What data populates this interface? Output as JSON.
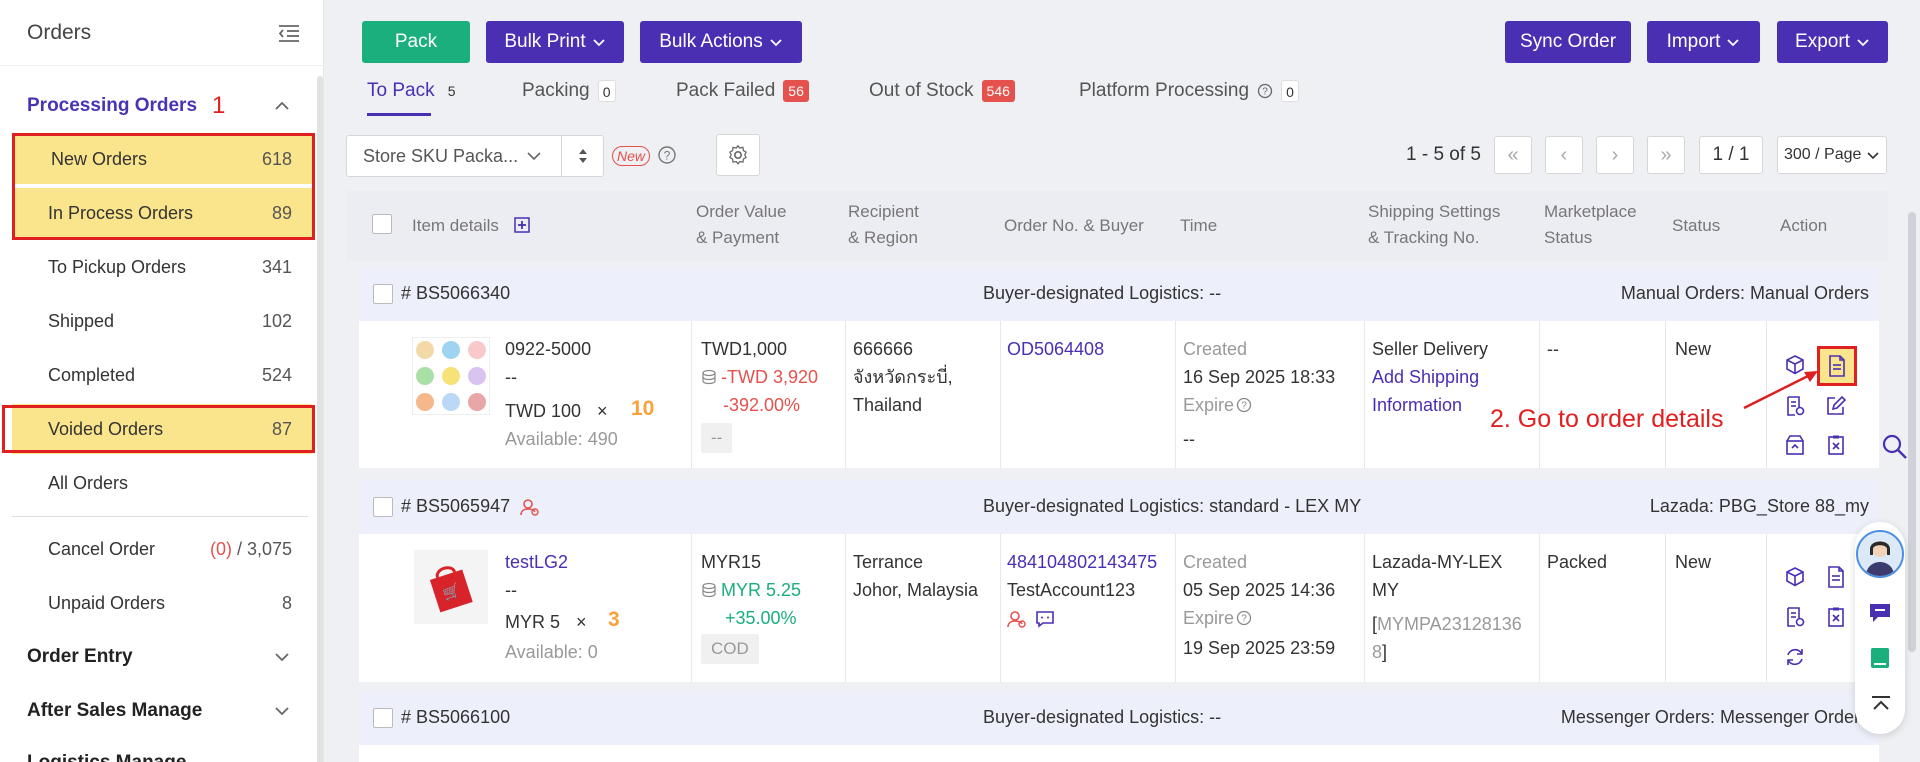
{
  "sidebar": {
    "title": "Orders",
    "processing_group": "Processing Orders",
    "items": [
      {
        "label": "New Orders",
        "count": "618"
      },
      {
        "label": "In Process Orders",
        "count": "89"
      },
      {
        "label": "To Pickup Orders",
        "count": "341"
      },
      {
        "label": "Shipped",
        "count": "102"
      },
      {
        "label": "Completed",
        "count": "524"
      },
      {
        "label": "Voided Orders",
        "count": "87"
      },
      {
        "label": "All Orders",
        "count": ""
      }
    ],
    "cancel_order": {
      "label": "Cancel Order",
      "count_highlight": "(0)",
      "count_total": " / 3,075"
    },
    "unpaid_orders": {
      "label": "Unpaid Orders",
      "count": "8"
    },
    "groups": [
      "Order Entry",
      "After Sales Manage",
      "Logistics Manage"
    ],
    "step1_marker": "1"
  },
  "toolbar": {
    "pack": "Pack",
    "bulk_print": "Bulk Print",
    "bulk_actions": "Bulk Actions",
    "sync_order": "Sync Order",
    "import": "Import",
    "export": "Export"
  },
  "tabs": [
    {
      "label": "To Pack",
      "count": "5",
      "style": "plain"
    },
    {
      "label": "Packing",
      "count": "0",
      "style": "plain"
    },
    {
      "label": "Pack Failed",
      "count": "56",
      "style": "red"
    },
    {
      "label": "Out of Stock",
      "count": "546",
      "style": "red"
    },
    {
      "label": "Platform Processing",
      "count": "0",
      "style": "plain"
    }
  ],
  "filter": {
    "select_text": "Store SKU Packa...",
    "new_tag": "New"
  },
  "pager": {
    "range": "1 - 5 of 5",
    "page": "1 / 1",
    "per_page": "300 / Page"
  },
  "table": {
    "headers": {
      "item": "Item details",
      "value_1": "Order Value",
      "value_2": "& Payment",
      "recip_1": "Recipient",
      "recip_2": "& Region",
      "order_no": "Order No. & Buyer",
      "time": "Time",
      "ship_1": "Shipping Settings",
      "ship_2": "& Tracking No.",
      "mkt_1": "Marketplace",
      "mkt_2": "Status",
      "status": "Status",
      "action": "Action"
    },
    "orders": [
      {
        "id": "# BS5066340",
        "logistics": "Buyer-designated Logistics: --",
        "store": "Manual Orders: Manual Orders",
        "sku": "0922-5000",
        "variant": "--",
        "unit_price": "TWD 100",
        "times": "×",
        "qty": "10",
        "available": "Available: 490",
        "value": "TWD1,000",
        "profit": "-TWD 3,920",
        "profit_pct": "-392.00%",
        "payment": "--",
        "recipient_1": "666666",
        "recipient_2": "จังหวัดกระบี่,",
        "recipient_3": "Thailand",
        "order_no": "OD5064408",
        "created_label": "Created",
        "created": "16 Sep 2025 18:33",
        "expire_label": "Expire",
        "expire": "--",
        "shipping_1": "Seller Delivery",
        "shipping_link_1": "Add Shipping",
        "shipping_link_2": "Information",
        "marketplace_status": "--",
        "status": "New"
      },
      {
        "id": "# BS5065947",
        "logistics": "Buyer-designated Logistics: standard - LEX MY",
        "store": "Lazada: PBG_Store 88_my",
        "sku": "testLG2",
        "variant": "--",
        "unit_price": "MYR 5",
        "times": "×",
        "qty": "3",
        "available": "Available: 0",
        "value": "MYR15",
        "profit": "MYR 5.25",
        "profit_pct": "+35.00%",
        "payment": "COD",
        "recipient_1": "Terrance",
        "recipient_2": "Johor, Malaysia",
        "order_no": "484104802143475",
        "buyer": "TestAccount123",
        "created_label": "Created",
        "created": "05 Sep 2025 14:36",
        "expire_label": "Expire",
        "expire": "19 Sep 2025 23:59",
        "shipping_1": "Lazada-MY-LEX",
        "shipping_2": "MY",
        "tracking_bracket_open": "[",
        "tracking_1": "MYMPA23128136",
        "tracking_2": "8",
        "tracking_bracket_close": "]",
        "marketplace_status": "Packed",
        "status": "New"
      },
      {
        "id": "# BS5066100",
        "logistics": "Buyer-designated Logistics: --",
        "store": "Messenger Orders: Messenger Orders"
      }
    ]
  },
  "annotation": "2. Go to order details",
  "colors": {
    "accent": "#4a2fb3",
    "green": "#1aaf7d",
    "red": "#e5514c",
    "highlight": "#fbe58c",
    "annotation": "#e02020"
  }
}
